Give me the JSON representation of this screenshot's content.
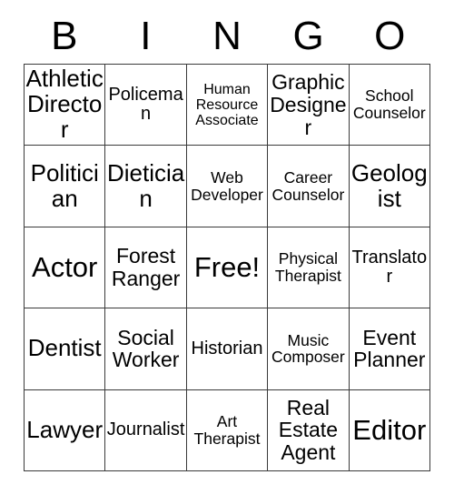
{
  "card": {
    "title": "BINGO",
    "headers": [
      "B",
      "I",
      "N",
      "G",
      "O"
    ],
    "rows": [
      [
        {
          "label": "Athletic Director",
          "size": "fs-xl"
        },
        {
          "label": "Policeman",
          "size": "fs-md"
        },
        {
          "label": "Human Resource Associate",
          "size": "fs-xs"
        },
        {
          "label": "Graphic Designer",
          "size": "fs-lg"
        },
        {
          "label": "School Counselor",
          "size": "fs-sm"
        }
      ],
      [
        {
          "label": "Politician",
          "size": "fs-xl"
        },
        {
          "label": "Dietician",
          "size": "fs-xl"
        },
        {
          "label": "Web Developer",
          "size": "fs-sm"
        },
        {
          "label": "Career Counselor",
          "size": "fs-sm"
        },
        {
          "label": "Geologist",
          "size": "fs-xl"
        }
      ],
      [
        {
          "label": "Actor",
          "size": "fs-xxl"
        },
        {
          "label": "Forest Ranger",
          "size": "fs-lg"
        },
        {
          "label": "Free!",
          "size": "fs-xxl"
        },
        {
          "label": "Physical Therapist",
          "size": "fs-sm"
        },
        {
          "label": "Translator",
          "size": "fs-md"
        }
      ],
      [
        {
          "label": "Dentist",
          "size": "fs-xl"
        },
        {
          "label": "Social Worker",
          "size": "fs-lg"
        },
        {
          "label": "Historian",
          "size": "fs-md"
        },
        {
          "label": "Music Composer",
          "size": "fs-sm"
        },
        {
          "label": "Event Planner",
          "size": "fs-lg"
        }
      ],
      [
        {
          "label": "Lawyer",
          "size": "fs-xl"
        },
        {
          "label": "Journalist",
          "size": "fs-md"
        },
        {
          "label": "Art Therapist",
          "size": "fs-sm"
        },
        {
          "label": "Real Estate Agent",
          "size": "fs-lg"
        },
        {
          "label": "Editor",
          "size": "fs-xxl"
        }
      ]
    ],
    "colors": {
      "background": "#ffffff",
      "text": "#000000",
      "grid_line": "#3a3a3a"
    }
  }
}
